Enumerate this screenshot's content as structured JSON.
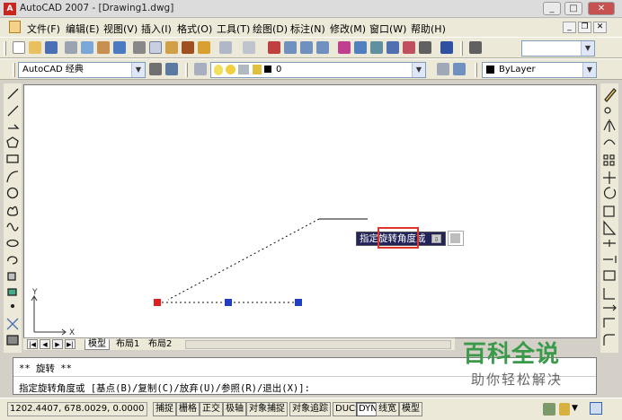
{
  "window": {
    "title": "AutoCAD 2007 - [Drawing1.dwg]",
    "app_icon_glyph": "A",
    "minimize_glyph": "_",
    "maximize_glyph": "□",
    "close_glyph": "✕"
  },
  "menubar": {
    "items": [
      "文件(F)",
      "编辑(E)",
      "视图(V)",
      "插入(I)",
      "格式(O)",
      "工具(T)",
      "绘图(D)",
      "标注(N)",
      "修改(M)",
      "窗口(W)",
      "帮助(H)"
    ],
    "doc_min_glyph": "_",
    "doc_restore_glyph": "❐",
    "doc_close_glyph": "✕"
  },
  "toolbar2": {
    "workspace": "AutoCAD 经典",
    "layer_value": "0",
    "linetype_value": "ByLayer"
  },
  "tabs": {
    "nav_glyphs": [
      "|◀",
      "◀",
      "▶",
      "▶|"
    ],
    "items": [
      "模型",
      "布局1",
      "布局2"
    ],
    "active_index": 0
  },
  "canvas": {
    "ucs_y": "Y",
    "ucs_x": "X",
    "grip_colors": [
      "#e02020",
      "#2040c0",
      "#2040c0"
    ]
  },
  "tooltip": {
    "prefix": "指定",
    "highlight": "旋转角度或",
    "button_glyph": "⇩"
  },
  "command": {
    "line1": "** 旋转 **",
    "line2": "指定旋转角度或 [基点(B)/复制(C)/放弃(U)/参照(R)/退出(X)]:"
  },
  "status": {
    "coords": "1202.4407, 678.0029, 0.0000",
    "buttons": [
      {
        "label": "捕捉",
        "on": false
      },
      {
        "label": "栅格",
        "on": false
      },
      {
        "label": "正交",
        "on": false
      },
      {
        "label": "极轴",
        "on": false
      },
      {
        "label": "对象捕捉",
        "on": false
      },
      {
        "label": "对象追踪",
        "on": false
      },
      {
        "label": "DUCS",
        "on": false
      },
      {
        "label": "DYN",
        "on": true
      },
      {
        "label": "线宽",
        "on": false
      },
      {
        "label": "模型",
        "on": false
      }
    ]
  },
  "watermark": {
    "title": "百科全说",
    "subtitle": "助你轻松解决"
  }
}
